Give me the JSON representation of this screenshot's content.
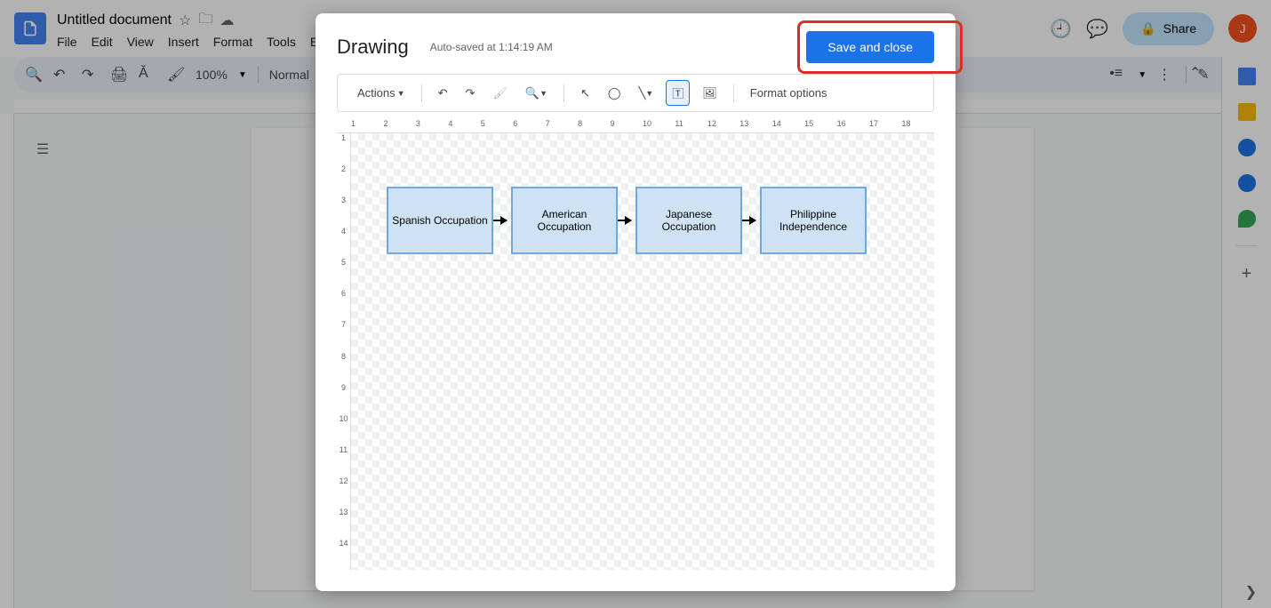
{
  "doc": {
    "title": "Untitled document"
  },
  "menu": [
    "File",
    "Edit",
    "View",
    "Insert",
    "Format",
    "Tools",
    "E"
  ],
  "toolbar": {
    "zoom": "100%",
    "style": "Normal"
  },
  "share": {
    "label": "Share",
    "avatar_initial": "J"
  },
  "modal": {
    "title": "Drawing",
    "autosave": "Auto-saved at 1:14:19 AM",
    "save_close": "Save and close",
    "actions_label": "Actions",
    "format_options": "Format options",
    "ruler_h": [
      "1",
      "2",
      "3",
      "4",
      "5",
      "6",
      "7",
      "8",
      "9",
      "10",
      "11",
      "12",
      "13",
      "14",
      "15",
      "16",
      "17",
      "18"
    ],
    "ruler_v": [
      "1",
      "2",
      "3",
      "4",
      "5",
      "6",
      "7",
      "8",
      "9",
      "10",
      "11",
      "12",
      "13",
      "14"
    ]
  },
  "flowchart": {
    "boxes": [
      {
        "label": "Spanish Occupation"
      },
      {
        "label": "American Occupation"
      },
      {
        "label": "Japanese Occupation"
      },
      {
        "label": "Philippine Independence"
      }
    ]
  }
}
